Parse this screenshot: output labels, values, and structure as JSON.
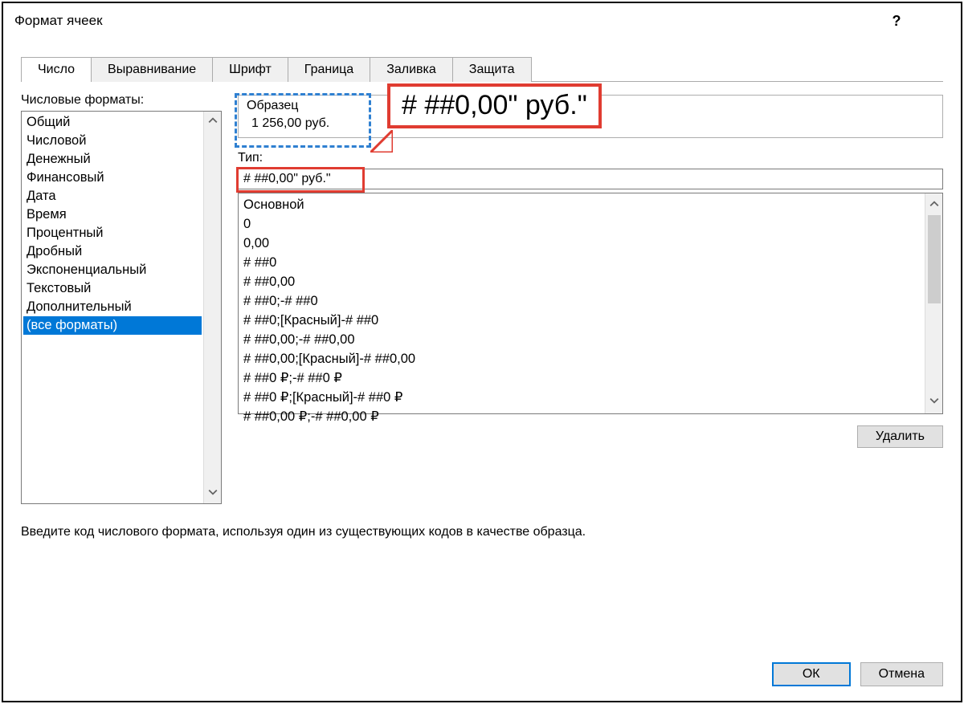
{
  "window": {
    "title": "Формат ячеек"
  },
  "tabs": {
    "t0": "Число",
    "t1": "Выравнивание",
    "t2": "Шрифт",
    "t3": "Граница",
    "t4": "Заливка",
    "t5": "Защита"
  },
  "left": {
    "label": "Числовые форматы:",
    "items": {
      "i0": "Общий",
      "i1": "Числовой",
      "i2": "Денежный",
      "i3": "Финансовый",
      "i4": "Дата",
      "i5": "Время",
      "i6": "Процентный",
      "i7": "Дробный",
      "i8": "Экспоненциальный",
      "i9": "Текстовый",
      "i10": "Дополнительный",
      "i11": "(все форматы)"
    }
  },
  "right": {
    "sample_label": "Образец",
    "sample_value": "1 256,00 руб.",
    "callout_text": "# ##0,00\" руб.\"",
    "type_label": "Тип:",
    "type_value": "# ##0,00\" руб.\"",
    "formats": {
      "f0": "Основной",
      "f1": "0",
      "f2": "0,00",
      "f3": "# ##0",
      "f4": "# ##0,00",
      "f5": "# ##0;-# ##0",
      "f6": "# ##0;[Красный]-# ##0",
      "f7": "# ##0,00;-# ##0,00",
      "f8": "# ##0,00;[Красный]-# ##0,00",
      "f9": "# ##0 ₽;-# ##0 ₽",
      "f10": "# ##0 ₽;[Красный]-# ##0 ₽",
      "f11": "# ##0,00 ₽;-# ##0,00 ₽"
    },
    "delete_label": "Удалить"
  },
  "hint": "Введите код числового формата, используя один из существующих кодов в качестве образца.",
  "footer": {
    "ok": "ОК",
    "cancel": "Отмена"
  }
}
